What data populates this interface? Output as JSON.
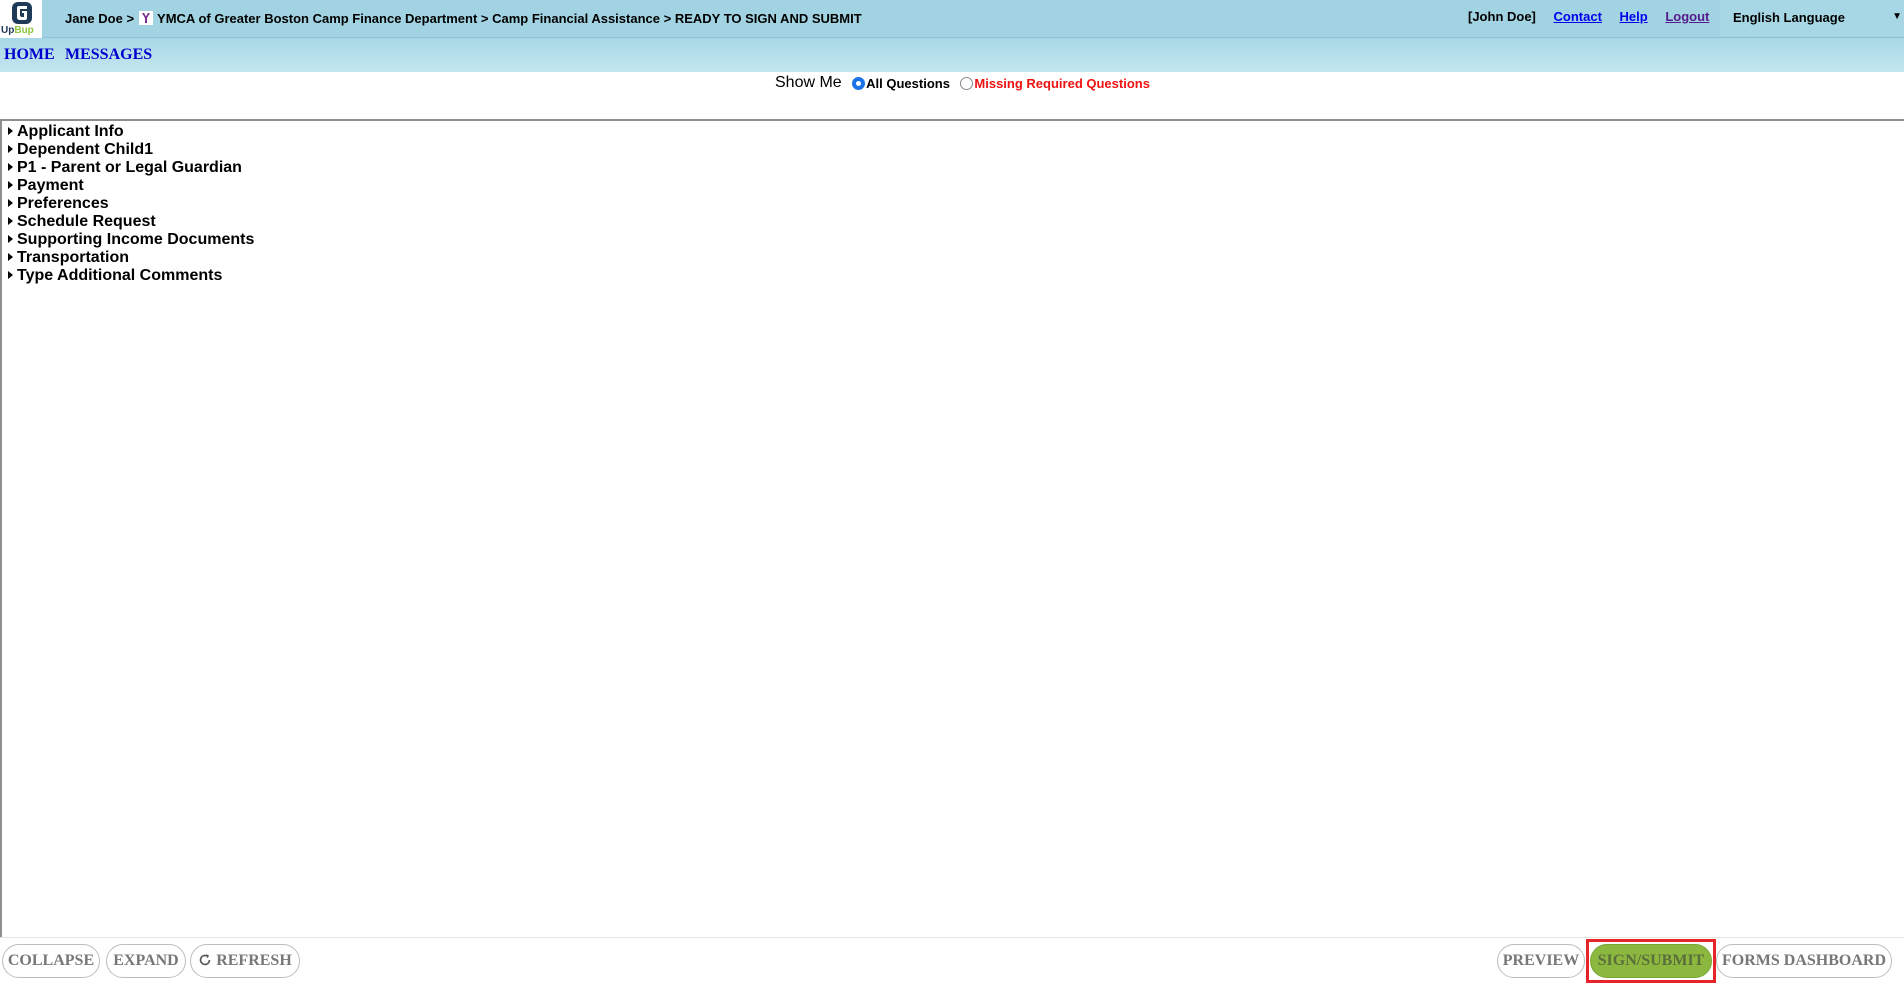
{
  "header": {
    "logo_text_main": "Up",
    "logo_text_accent": "Bup",
    "breadcrumb": {
      "user": "Jane Doe",
      "sep1": ">",
      "org": "YMCA of Greater Boston Camp Finance Department",
      "sep2": ">",
      "program": "Camp Financial Assistance",
      "sep3": ">",
      "status": "READY TO SIGN AND SUBMIT"
    },
    "account": "[John  Doe]",
    "links": {
      "contact": "Contact",
      "help": "Help",
      "logout": "Logout"
    },
    "language": "English Language"
  },
  "nav": {
    "home": "HOME",
    "messages": "MESSAGES"
  },
  "filter": {
    "label": "Show Me",
    "options": [
      {
        "label": "All Questions",
        "checked": true
      },
      {
        "label": "Missing Required Questions",
        "checked": false
      }
    ]
  },
  "sections": [
    "Applicant Info",
    "Dependent Child1",
    "P1 - Parent or Legal Guardian",
    "Payment",
    "Preferences",
    "Schedule Request",
    "Supporting Income Documents",
    "Transportation",
    "Type Additional Comments"
  ],
  "footer": {
    "collapse": "COLLAPSE",
    "expand": "EXPAND",
    "refresh": "REFRESH",
    "preview": "PREVIEW",
    "sign_submit": "SIGN/SUBMIT",
    "forms_dashboard": "FORMS DASHBOARD"
  },
  "colors": {
    "header_bg": "#a2d3e2",
    "nav_link": "#0000cc",
    "missing_required": "#ee1111",
    "primary_button": "#8cb83f",
    "highlight": "#e8242a"
  }
}
